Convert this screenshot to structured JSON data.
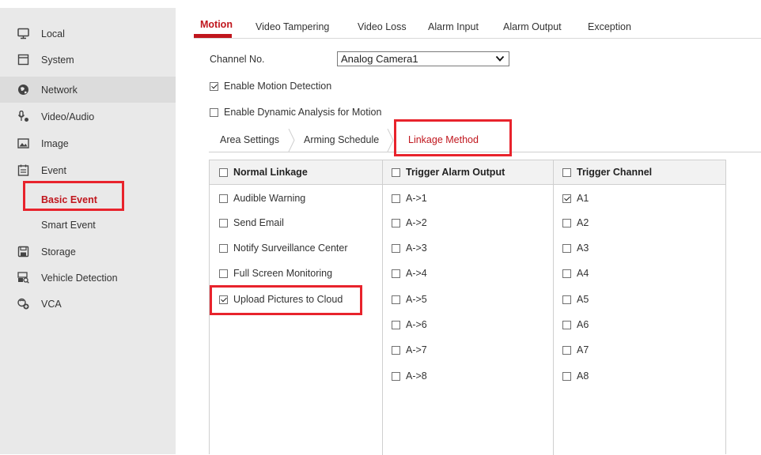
{
  "sidebar": {
    "items": [
      {
        "label": "Local",
        "icon": "monitor-icon"
      },
      {
        "label": "System",
        "icon": "system-icon"
      },
      {
        "label": "Network",
        "icon": "globe-icon"
      },
      {
        "label": "Video/Audio",
        "icon": "video-audio-icon"
      },
      {
        "label": "Image",
        "icon": "image-icon"
      },
      {
        "label": "Event",
        "icon": "calendar-icon"
      },
      {
        "label": "Storage",
        "icon": "storage-icon"
      },
      {
        "label": "Vehicle Detection",
        "icon": "vehicle-detection-icon"
      },
      {
        "label": "VCA",
        "icon": "vca-icon"
      }
    ],
    "event_sub": [
      {
        "label": "Basic Event",
        "selected": true
      },
      {
        "label": "Smart Event",
        "selected": false
      }
    ]
  },
  "tabs": [
    "Motion",
    "Video Tampering",
    "Video Loss",
    "Alarm Input",
    "Alarm Output",
    "Exception"
  ],
  "form": {
    "channel_label": "Channel No.",
    "channel_value": "Analog Camera1",
    "enable_motion": {
      "label": "Enable Motion Detection",
      "checked": true
    },
    "enable_dynamic": {
      "label": "Enable Dynamic Analysis for Motion",
      "checked": false
    }
  },
  "subtabs": [
    "Area Settings",
    "Arming Schedule",
    "Linkage Method"
  ],
  "table": {
    "headers": [
      "Normal Linkage",
      "Trigger Alarm Output",
      "Trigger Channel"
    ],
    "normal_linkage": [
      {
        "label": "Audible Warning",
        "checked": false
      },
      {
        "label": "Send Email",
        "checked": false
      },
      {
        "label": "Notify Surveillance Center",
        "checked": false
      },
      {
        "label": "Full Screen Monitoring",
        "checked": false
      },
      {
        "label": "Upload Pictures to Cloud",
        "checked": true
      }
    ],
    "alarm_outputs": [
      {
        "label": "A->1",
        "checked": false
      },
      {
        "label": "A->2",
        "checked": false
      },
      {
        "label": "A->3",
        "checked": false
      },
      {
        "label": "A->4",
        "checked": false
      },
      {
        "label": "A->5",
        "checked": false
      },
      {
        "label": "A->6",
        "checked": false
      },
      {
        "label": "A->7",
        "checked": false
      },
      {
        "label": "A->8",
        "checked": false
      }
    ],
    "channels": [
      {
        "label": "A1",
        "checked": true
      },
      {
        "label": "A2",
        "checked": false
      },
      {
        "label": "A3",
        "checked": false
      },
      {
        "label": "A4",
        "checked": false
      },
      {
        "label": "A5",
        "checked": false
      },
      {
        "label": "A6",
        "checked": false
      },
      {
        "label": "A7",
        "checked": false
      },
      {
        "label": "A8",
        "checked": false
      }
    ]
  },
  "colors": {
    "accent": "#c0161d",
    "highlight": "#e8232c"
  }
}
